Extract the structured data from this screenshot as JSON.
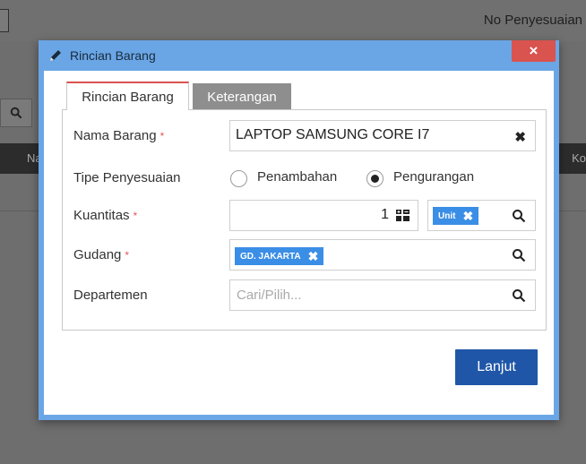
{
  "background": {
    "doc_label": "No Penyesuaian",
    "table_col_left": "Na",
    "table_col_right": "Ko"
  },
  "modal": {
    "title": "Rincian Barang",
    "close_label": "×",
    "tabs": [
      {
        "label": "Rincian Barang",
        "active": true
      },
      {
        "label": "Keterangan",
        "active": false
      }
    ],
    "fields": {
      "nama_barang": {
        "label": "Nama Barang",
        "required_mark": "*",
        "value": "LAPTOP SAMSUNG CORE I7",
        "clear_label": "✖"
      },
      "tipe_penyesuaian": {
        "label": "Tipe Penyesuaian",
        "options": [
          {
            "label": "Penambahan",
            "selected": false
          },
          {
            "label": "Pengurangan",
            "selected": true
          }
        ]
      },
      "kuantitas": {
        "label": "Kuantitas",
        "required_mark": "*",
        "value": "1",
        "unit_tag": "Unit",
        "tag_remove": "✖"
      },
      "gudang": {
        "label": "Gudang",
        "required_mark": "*",
        "tag": "GD. JAKARTA",
        "tag_remove": "✖"
      },
      "departemen": {
        "label": "Departemen",
        "placeholder": "Cari/Pilih..."
      }
    },
    "submit_label": "Lanjut"
  },
  "colors": {
    "header": "#6aa6e6",
    "close": "#d9534f",
    "primary": "#1f56a8",
    "tag": "#3a8ee6",
    "required": "#e05a5a"
  }
}
